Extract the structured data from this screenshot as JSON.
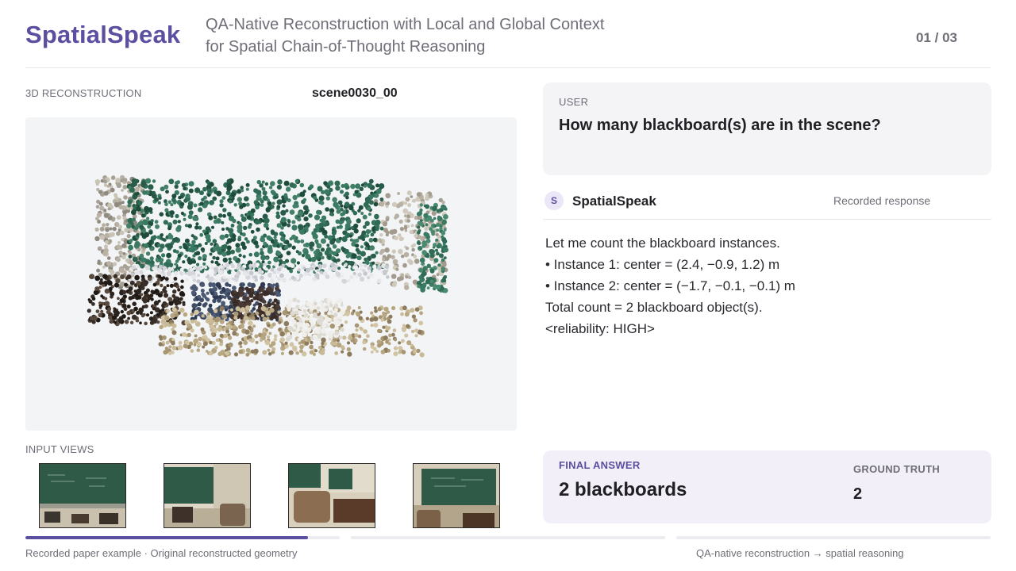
{
  "header": {
    "brand": "SpatialSpeak",
    "subtitle_line1": "QA-Native Reconstruction with Local and Global Context",
    "subtitle_line2": "for Spatial Chain-of-Thought Reasoning",
    "pager": "01 / 03"
  },
  "left": {
    "recon_label": "3D RECONSTRUCTION",
    "scene_id": "scene0030_00",
    "views_label": "INPUT VIEWS",
    "thumb_count": 4
  },
  "progress": {
    "segments": [
      {
        "fill": 0.9
      },
      {
        "fill": 0
      },
      {
        "fill": 0
      }
    ]
  },
  "footer": {
    "left": "Recorded paper example · Original reconstructed geometry",
    "right": "QA-native reconstruction → spatial reasoning"
  },
  "chat": {
    "user_role": "USER",
    "question": "How many blackboard(s) are in the scene?",
    "avatar_letter": "S",
    "assistant_name": "SpatialSpeak",
    "response_tag": "Recorded response",
    "response_lines": [
      "Let me count the blackboard instances.",
      "• Instance 1: center = (2.4, −0.9, 1.2) m",
      "• Instance 2: center = (−1.7, −0.1, −0.1) m",
      "Total count = 2 blackboard object(s).",
      "<reliability: HIGH>"
    ]
  },
  "answer": {
    "final_label": "FINAL ANSWER",
    "final_value": "2 blackboards",
    "gt_label": "GROUND TRUTH",
    "gt_value": "2"
  },
  "colors": {
    "accent": "#5b4fa0",
    "muted_text": "#6e6e78",
    "card_bg": "#f4f4f6",
    "answer_bg": "#f2eff8",
    "blackboard_green": "#2f6b55"
  }
}
